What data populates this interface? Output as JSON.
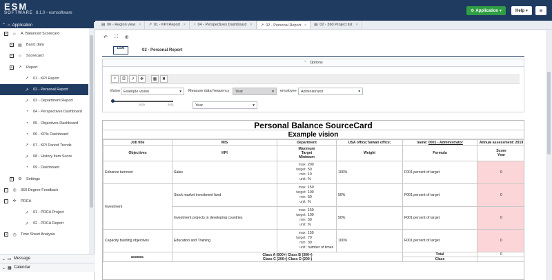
{
  "brand": {
    "logo_main": "ESM",
    "logo_sub": "SOFTWARE",
    "version": "8.1.0 - esmsoftware"
  },
  "header": {
    "app_label": "Application",
    "help_label": "Help"
  },
  "sidebar": {
    "head": "Application",
    "items": [
      {
        "label": "A. Balanced Scorecard"
      },
      {
        "label": "Basic data"
      },
      {
        "label": "Scorecard"
      },
      {
        "label": "Report"
      },
      {
        "label": "01 - KPI Report"
      },
      {
        "label": "02 - Personal Report"
      },
      {
        "label": "03 - Department Report"
      },
      {
        "label": "04 - Perspectives Dashboard"
      },
      {
        "label": "05 - Objectives Dashboard"
      },
      {
        "label": "06 - KPIs Dashboard"
      },
      {
        "label": "07 - KPI Period Trends"
      },
      {
        "label": "08 - History Item Score"
      },
      {
        "label": "09 - Dashboard"
      },
      {
        "label": "Settings"
      },
      {
        "label": "360 Degree Feedback"
      },
      {
        "label": "PDCA"
      },
      {
        "label": "01 - PDCA Project"
      },
      {
        "label": "02 - PDCA Report"
      },
      {
        "label": "Time Sheet Analysis"
      }
    ],
    "message": "Message",
    "calendar": "Calendar"
  },
  "tabs": [
    {
      "label": "06 - Region view"
    },
    {
      "label": "01 - KPI Report"
    },
    {
      "label": "04 - Perspectives Dashboard"
    },
    {
      "label": "02 - Personal Report"
    },
    {
      "label": "02 - 360 Project list"
    }
  ],
  "content": {
    "logo_text": "ESM",
    "title": "02 - Personal Report",
    "options_label": "Options",
    "vision_label": "Vision",
    "vision_value": "Example vision",
    "freq_label": "Measure data frequency",
    "freq_value": "Year",
    "employee_label": "employee",
    "employee_value": "Administrator",
    "slider_ticks": [
      "2020",
      "2021"
    ],
    "year_value": "Year"
  },
  "report": {
    "title": "Personal Balance SourceCard",
    "subtitle": "Example vision",
    "job_title_label": "Job title",
    "job_title_value": "MIS",
    "department_label": "Department",
    "department_value": "USA office;Taiwan office;",
    "name_label": "name:",
    "name_value": "0001 - Administrator",
    "annual_label": "Annual assessment: 2019",
    "headers": {
      "objectives": "Objectives",
      "kpi": "KPI",
      "maximum": "Maximum",
      "target": "Target",
      "minimum": "Minimum",
      "weight": "Weight",
      "formula": "Formula",
      "score": "Score",
      "year": "Year"
    },
    "labels": {
      "max": "max:",
      "target": "target:",
      "min": "min:",
      "unit": "unit:"
    },
    "rows": [
      {
        "objective": "Enhance turnover",
        "kpi": "Sales",
        "max": "200",
        "target": "50",
        "min": "10",
        "unit": "%",
        "weight": "100%",
        "formula": "F001 percent of target",
        "score": "0"
      },
      {
        "objective": "Investment",
        "kpi": "Stock market investment fund",
        "max": "150",
        "target": "100",
        "min": "50",
        "unit": "%",
        "weight": "50%",
        "formula": "F001 percent of target",
        "score": "0"
      },
      {
        "objective": "",
        "kpi": "Investment projects in developing countries",
        "max": "150",
        "target": "100",
        "min": "50",
        "unit": "%",
        "weight": "50%",
        "formula": "F001 percent of target",
        "score": "0"
      },
      {
        "objective": "Capacity building objectives",
        "kpi": "Education and Training",
        "max": "150",
        "target": "70",
        "min": "30",
        "unit": "number of times",
        "weight": "100%",
        "formula": "F001 percent of target",
        "score": "0"
      }
    ],
    "assess_label": "assess:",
    "class_line1": "Class A (500+) Class B (300+)",
    "class_line2": "Class C (200+) Class D (200-)",
    "total_label": "Total",
    "total_value": "0",
    "class_label": "Class"
  }
}
